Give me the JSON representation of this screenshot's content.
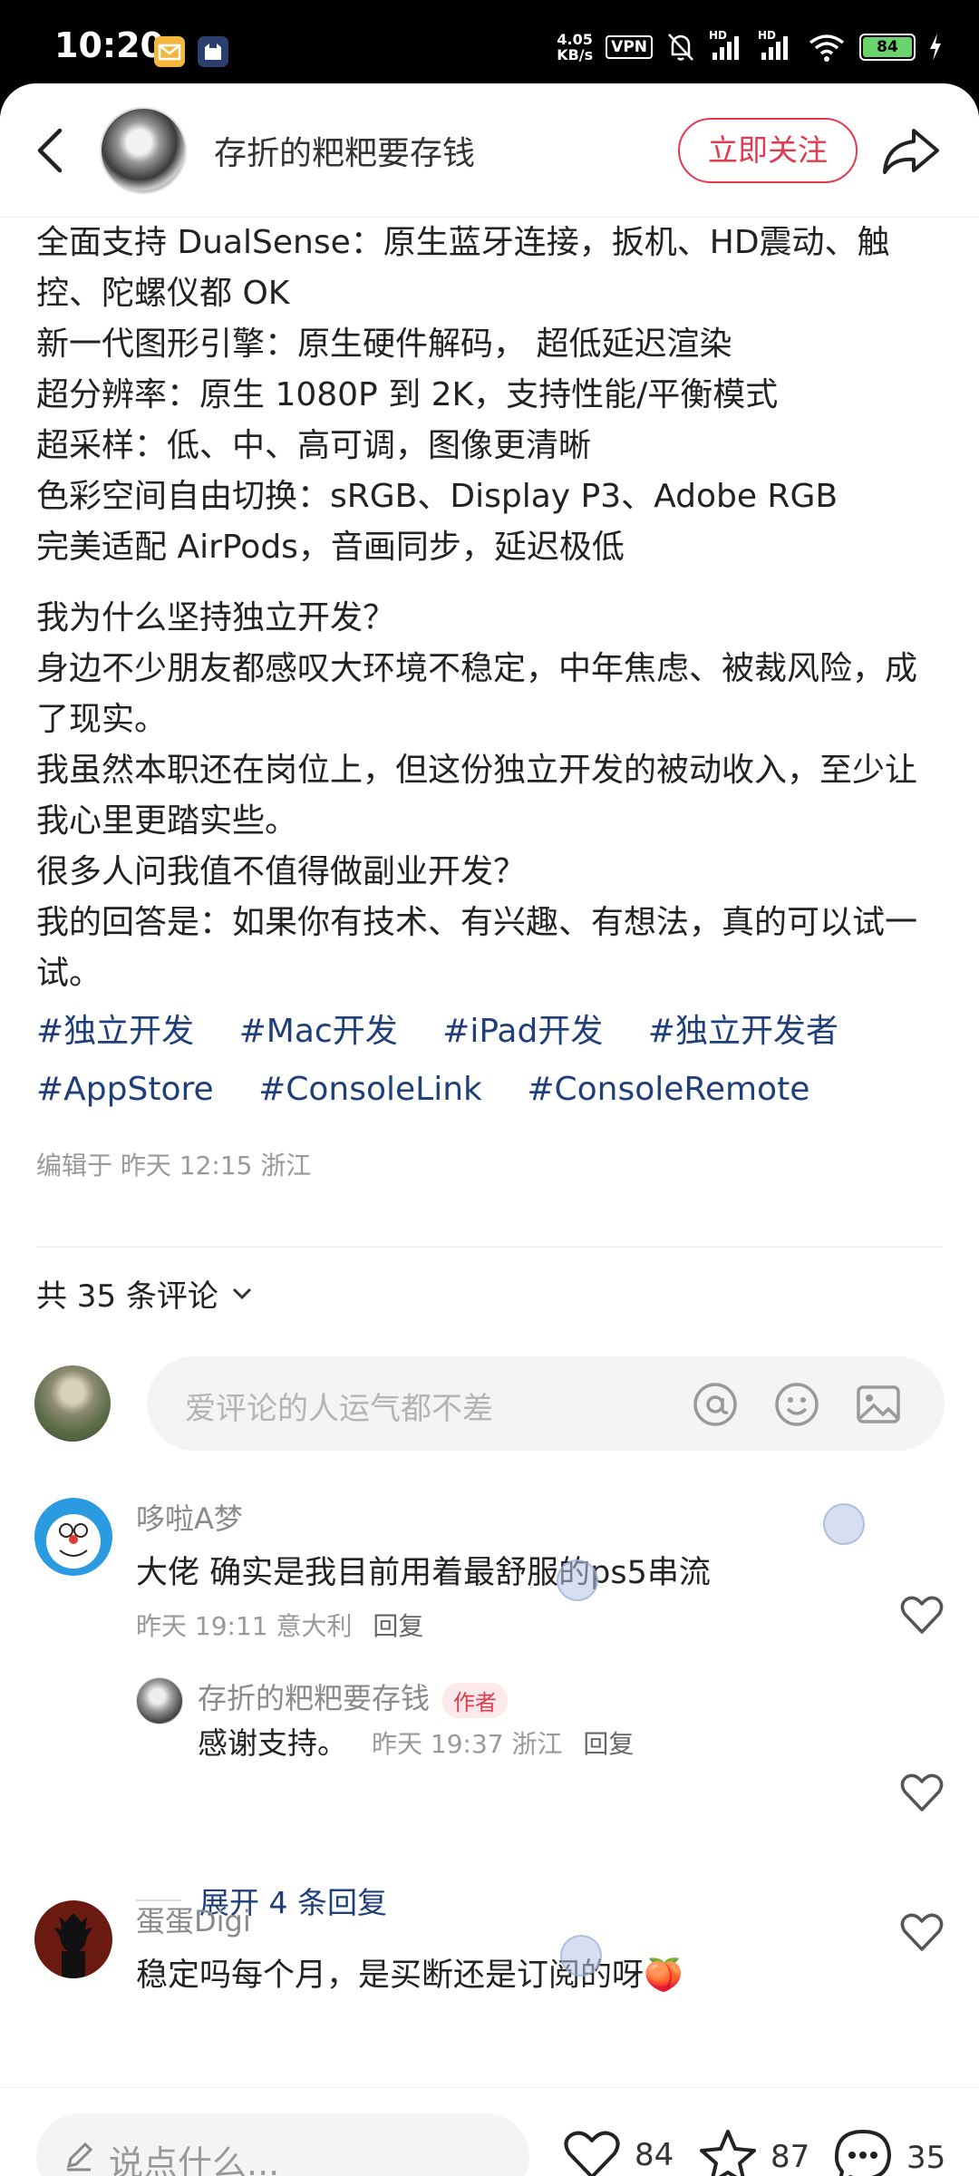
{
  "status_bar": {
    "time": "10:20",
    "net_speed_value": "4.05",
    "net_speed_unit": "KB/s",
    "vpn_label": "VPN",
    "hd1": "HD",
    "hd2": "HD",
    "battery": "84"
  },
  "header": {
    "author_name": "存折的粑粑要存钱",
    "follow_label": "立即关注"
  },
  "post": {
    "para1": [
      "全面支持 DualSense：原生蓝牙连接，扳机、HD震动、触控、陀螺仪都 OK",
      "新一代图形引擎：原生硬件解码， 超低延迟渲染",
      "超分辨率：原生 1080P 到 2K，支持性能/平衡模式",
      "超采样：低、中、高可调，图像更清晰",
      "色彩空间自由切换：sRGB、Display P3、Adobe RGB",
      "完美适配 AirPods，音画同步，延迟极低"
    ],
    "para2": [
      "我为什么坚持独立开发？",
      "身边不少朋友都感叹大环境不稳定，中年焦虑、被裁风险，成了现实。",
      "我虽然本职还在岗位上，但这份独立开发的被动收入，至少让我心里更踏实些。",
      "很多人问我值不值得做副业开发？",
      "我的回答是：如果你有技术、有兴趣、有想法，真的可以试一试。"
    ],
    "tags": [
      "#独立开发",
      "#Mac开发",
      "#iPad开发",
      "#独立开发者",
      "#AppStore",
      "#ConsoleLink",
      "#ConsoleRemote"
    ],
    "edited": "编辑于 昨天 12:15 浙江"
  },
  "comments_header": {
    "count_label": "共 35 条评论"
  },
  "comment_input": {
    "placeholder": "爱评论的人运气都不差"
  },
  "comments": [
    {
      "name": "哆啦A梦",
      "text": "大佬  确实是我目前用着最舒服的ps5串流",
      "time": "昨天 19:11 意大利",
      "reply": "回复"
    },
    {
      "name": "存折的粑粑要存钱",
      "badge": "作者",
      "text": "感谢支持。",
      "time": "昨天 19:37 浙江",
      "reply": "回复"
    },
    {
      "name": "蛋蛋Digi",
      "text": "稳定吗每个月，是买断还是订阅的呀🍑"
    }
  ],
  "expand_replies": "展开 4 条回复",
  "bottom_bar": {
    "placeholder": "说点什么...",
    "likes": "84",
    "favorites": "87",
    "comments": "35"
  },
  "colors": {
    "accent": "#e23a4e",
    "tag": "#1f3f7a"
  }
}
